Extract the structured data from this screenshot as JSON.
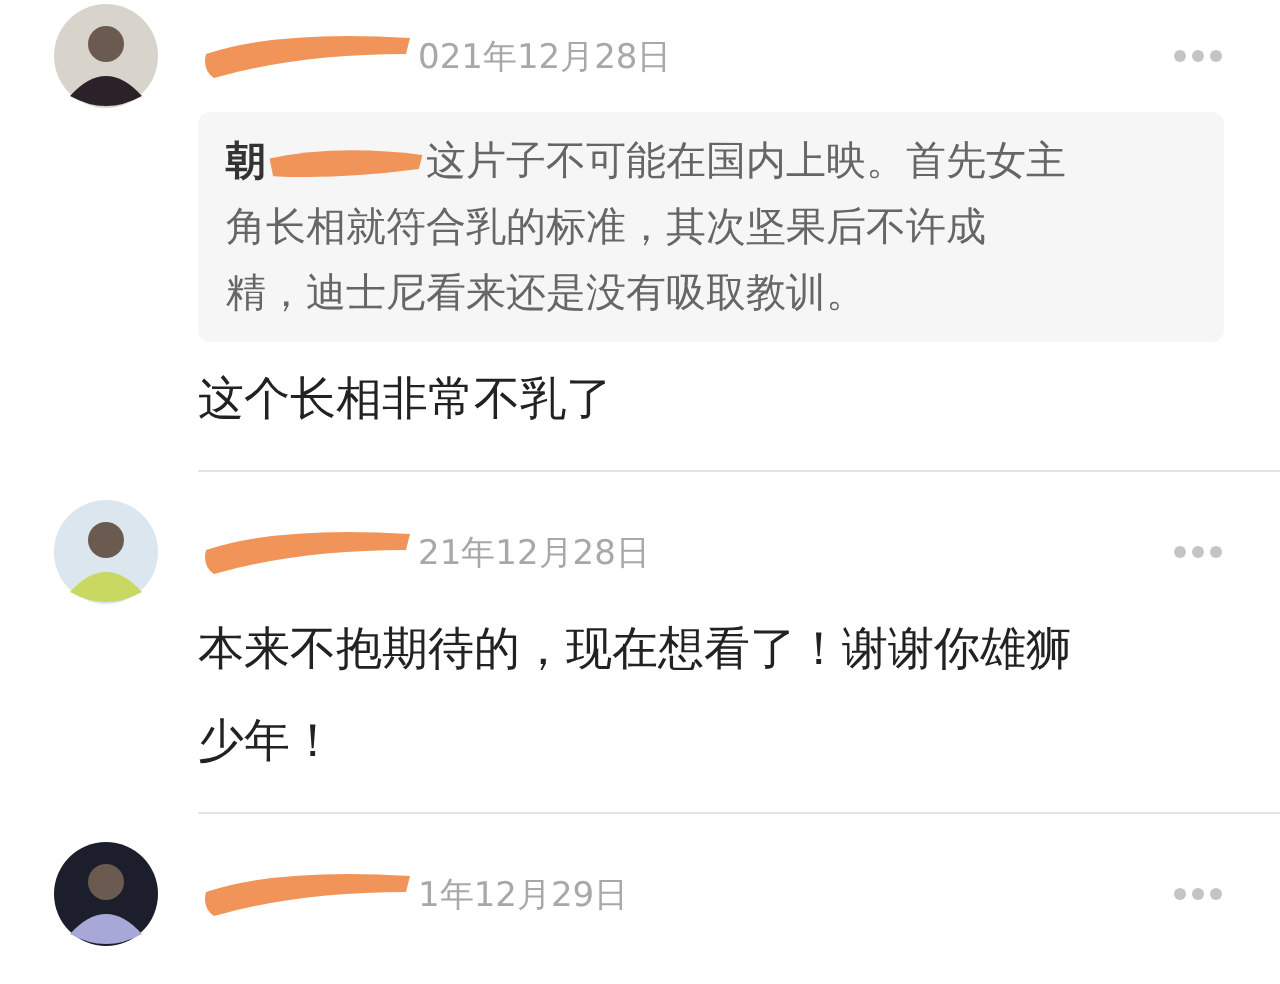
{
  "comments": [
    {
      "date": "021年12月28日",
      "quote": {
        "prefix": "朝",
        "lines": [
          "这片子不可能在国内上映。首先女主",
          "角长相就符合乳的标准，其次坚果后不许成",
          "精，迪士尼看来还是没有吸取教训。"
        ]
      },
      "text": "这个长相非常不乳了"
    },
    {
      "date": "21年12月28日",
      "text": "本来不抱期待的，现在想看了！谢谢你雄狮少年！"
    },
    {
      "date": "1年12月29日"
    }
  ]
}
